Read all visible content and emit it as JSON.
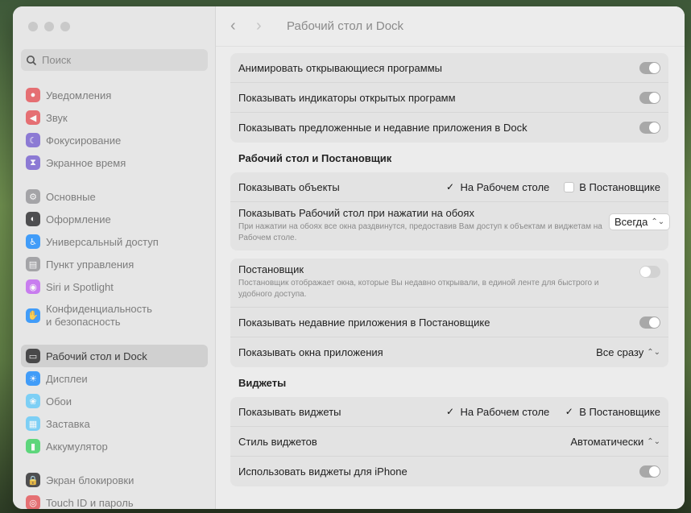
{
  "window": {
    "title": "Рабочий стол и Dock"
  },
  "search": {
    "placeholder": "Поиск"
  },
  "sidebar": {
    "groups": [
      [
        {
          "label": "Уведомления",
          "icon": "bell-icon",
          "color": "#e5484d"
        },
        {
          "label": "Звук",
          "icon": "speaker-icon",
          "color": "#e5484d"
        },
        {
          "label": "Фокусирование",
          "icon": "moon-icon",
          "color": "#6e56cf"
        },
        {
          "label": "Экранное время",
          "icon": "hourglass-icon",
          "color": "#6e56cf"
        }
      ],
      [
        {
          "label": "Основные",
          "icon": "gear-icon",
          "color": "#8e8e93"
        },
        {
          "label": "Оформление",
          "icon": "appearance-icon",
          "color": "#1c1c1e"
        },
        {
          "label": "Универсальный доступ",
          "icon": "accessibility-icon",
          "color": "#0a84ff"
        },
        {
          "label": "Пункт управления",
          "icon": "control-center-icon",
          "color": "#8e8e93"
        },
        {
          "label": "Siri и Spotlight",
          "icon": "siri-icon",
          "color": "#bf5af2"
        },
        {
          "label_line1": "Конфиденциальность",
          "label_line2": "и безопасность",
          "icon": "hand-icon",
          "color": "#0a84ff"
        }
      ],
      [
        {
          "label": "Рабочий стол и Dock",
          "icon": "dock-icon",
          "color": "#1c1c1e",
          "selected": true
        },
        {
          "label": "Дисплеи",
          "icon": "sun-icon",
          "color": "#0a84ff"
        },
        {
          "label": "Обои",
          "icon": "wallpaper-icon",
          "color": "#5ac8fa"
        },
        {
          "label": "Заставка",
          "icon": "screensaver-icon",
          "color": "#5ac8fa"
        },
        {
          "label": "Аккумулятор",
          "icon": "battery-icon",
          "color": "#30d158"
        }
      ],
      [
        {
          "label": "Экран блокировки",
          "icon": "lock-icon",
          "color": "#1c1c1e"
        },
        {
          "label": "Touch ID и пароль",
          "icon": "fingerprint-icon",
          "color": "#e5484d"
        }
      ]
    ]
  },
  "settings": {
    "top_rows": [
      {
        "label": "Анимировать открывающиеся программы",
        "on": true
      },
      {
        "label": "Показывать индикаторы открытых программ",
        "on": true
      },
      {
        "label": "Показывать предложенные и недавние приложения в Dock",
        "on": true
      }
    ],
    "desktop_section": {
      "title": "Рабочий стол и Постановщик",
      "show_items_label": "Показывать объекты",
      "show_items_desktop": "На Рабочем столе",
      "show_items_manager": "В Постановщике",
      "click_wallpaper_label": "Показывать Рабочий стол при нажатии на обоях",
      "click_wallpaper_desc": "При нажатии на обоях все окна раздвинутся, предоставив Вам доступ к объектам и виджетам на Рабочем столе.",
      "click_wallpaper_value": "Всегда"
    },
    "stage_manager": {
      "label": "Постановщик",
      "desc": "Постановщик отображает окна, которые Вы недавно открывали, в единой ленте для быстрого и удобного доступа.",
      "on": false,
      "recent_apps_label": "Показывать недавние приложения в Постановщике",
      "recent_apps_on": true,
      "app_windows_label": "Показывать окна приложения",
      "app_windows_value": "Все сразу"
    },
    "widgets_section": {
      "title": "Виджеты",
      "show_widgets_label": "Показывать виджеты",
      "show_desktop": "На Рабочем столе",
      "show_manager": "В Постановщике",
      "style_label": "Стиль виджетов",
      "style_value": "Автоматически",
      "iphone_label": "Использовать виджеты для iPhone"
    }
  }
}
